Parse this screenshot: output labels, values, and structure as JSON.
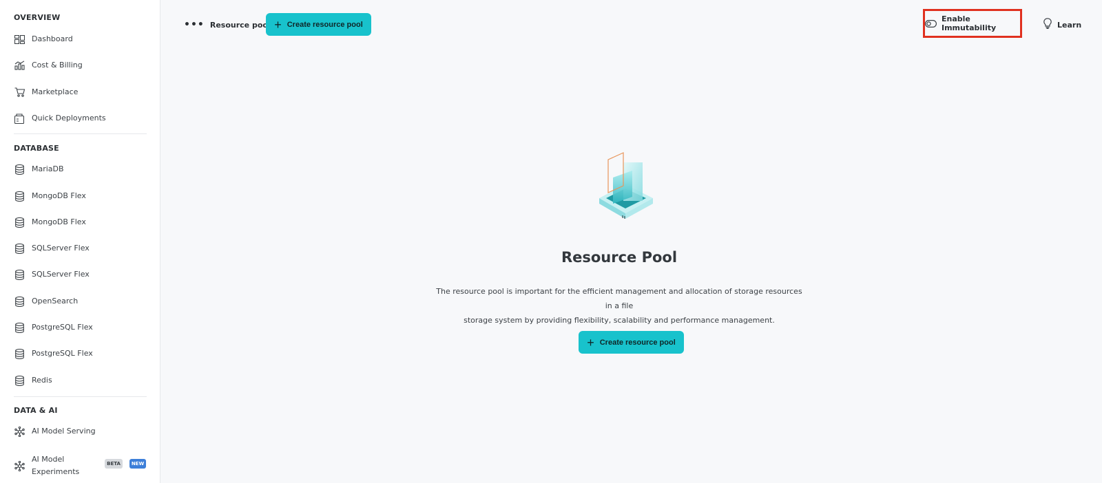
{
  "sidebar": {
    "sections": [
      {
        "title": "OVERVIEW"
      },
      {
        "title": "DATABASE"
      },
      {
        "title": "DATA & AI"
      }
    ],
    "overview_items": [
      {
        "label": "Dashboard",
        "icon": "dashboard-icon"
      },
      {
        "label": "Cost & Billing",
        "icon": "chart-icon"
      },
      {
        "label": "Marketplace",
        "icon": "cart-icon"
      },
      {
        "label": "Quick Deployments",
        "icon": "package-icon"
      }
    ],
    "database_items": [
      {
        "label": "MariaDB",
        "icon": "database-icon"
      },
      {
        "label": "MongoDB Flex",
        "icon": "database-icon"
      },
      {
        "label": "MongoDB Flex",
        "icon": "database-icon"
      },
      {
        "label": "SQLServer Flex",
        "icon": "database-icon"
      },
      {
        "label": "SQLServer Flex",
        "icon": "database-icon"
      },
      {
        "label": "OpenSearch",
        "icon": "database-icon"
      },
      {
        "label": "PostgreSQL Flex",
        "icon": "database-icon"
      },
      {
        "label": "PostgreSQL Flex",
        "icon": "database-icon"
      },
      {
        "label": "Redis",
        "icon": "database-icon"
      }
    ],
    "ai_items": [
      {
        "label": "AI Model Serving",
        "icon": "ai-icon"
      },
      {
        "label_line1": "AI Model",
        "label_line2": "Experiments",
        "icon": "ai-icon",
        "badges": [
          "BETA",
          "NEW"
        ]
      }
    ]
  },
  "toolbar": {
    "more_label": "Resource pool",
    "create_label": "Create resource pool",
    "immutability_label": "Enable Immutability",
    "learn_label": "Learn"
  },
  "empty_state": {
    "title": "Resource Pool",
    "description_line1": "The resource pool is important for the efficient management and allocation of storage resources in a file",
    "description_line2": "storage system by providing flexibility, scalability and performance management.",
    "create_label": "Create resource pool"
  },
  "colors": {
    "accent": "#18c2cc",
    "highlight": "#e0311f",
    "new_badge": "#3d7fd9"
  }
}
